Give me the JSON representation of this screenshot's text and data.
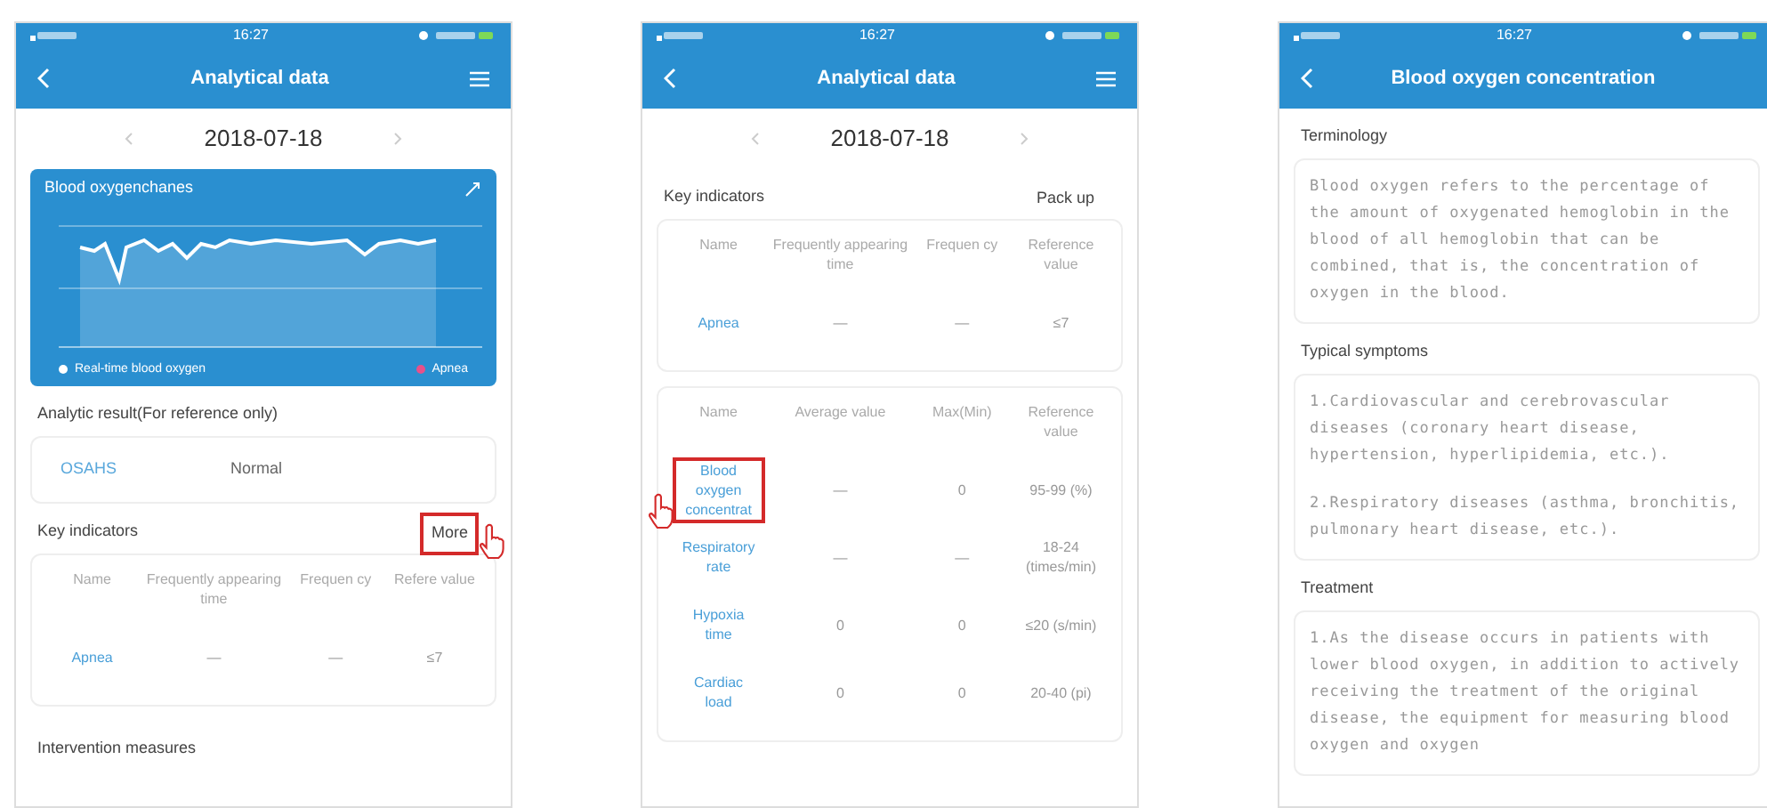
{
  "screens": [
    {
      "time": "16:27",
      "title": "Analytical data",
      "menu": true,
      "sections": [
        {
          "kind": "date",
          "label": "2018-07-18"
        },
        {
          "kind": "chart",
          "title": "Blood oxygenchanes",
          "legend": [
            {
              "label": "Real-time blood oxygen",
              "color": "#ffffff"
            },
            {
              "label": "Apnea",
              "color": "#e8508a"
            }
          ]
        },
        {
          "kind": "heading",
          "label": "Analytic result(For reference only)"
        },
        {
          "kind": "result",
          "name": "OSAHS",
          "value": "Normal"
        },
        {
          "kind": "heading",
          "label": "Key indicators",
          "action": {
            "label": "More",
            "highlighted": true
          }
        },
        {
          "kind": "table",
          "columns": [
            "Name",
            "Frequently appearing time",
            "Frequen cy",
            "Refere value"
          ],
          "rows": [
            {
              "cells": [
                "Apnea",
                "—",
                "—",
                "≤7"
              ],
              "highlighted": false
            }
          ]
        },
        {
          "kind": "heading",
          "label": "Intervention measures"
        }
      ]
    },
    {
      "time": "16:27",
      "title": "Analytical data",
      "menu": true,
      "sections": [
        {
          "kind": "date",
          "label": "2018-07-18"
        },
        {
          "kind": "heading",
          "label": "Key indicators",
          "action": {
            "label": "Pack up",
            "highlighted": false
          }
        },
        {
          "kind": "table",
          "columns": [
            "Name",
            "Frequently appearing time",
            "Frequen cy",
            "Reference value"
          ],
          "rows": [
            {
              "cells": [
                "Apnea",
                "—",
                "—",
                "≤7"
              ],
              "highlighted": false
            }
          ]
        },
        {
          "kind": "table",
          "columns": [
            "Name",
            "Average value",
            "Max(Min)",
            "Reference value"
          ],
          "rows": [
            {
              "cells": [
                "Blood oxygen concentrat",
                "—",
                "0",
                "95-99 (%)"
              ],
              "highlighted": true
            },
            {
              "cells": [
                "Respiratory rate",
                "—",
                "—",
                "18-24 (times/min)"
              ],
              "highlighted": false
            },
            {
              "cells": [
                "Hypoxia time",
                "0",
                "0",
                "≤20 (s/min)"
              ],
              "highlighted": false
            },
            {
              "cells": [
                "Cardiac load",
                "0",
                "0",
                "20-40 (pi)"
              ],
              "highlighted": false
            }
          ]
        }
      ]
    },
    {
      "time": "16:27",
      "title": "Blood oxygen concentration",
      "menu": false,
      "sections": [
        {
          "kind": "heading",
          "label": "Terminology"
        },
        {
          "kind": "text",
          "paragraphs": [
            "Blood oxygen refers to the percentage of the amount of oxygenated hemoglobin in the blood of all hemoglobin that can be combined, that is, the concentration of oxygen in the blood."
          ]
        },
        {
          "kind": "heading",
          "label": "Typical symptoms"
        },
        {
          "kind": "text",
          "paragraphs": [
            "1.Cardiovascular and cerebrovascular diseases (coronary heart disease, hypertension, hyperlipidemia, etc.).",
            "2.Respiratory diseases (asthma, bronchitis, pulmonary heart disease, etc.)."
          ]
        },
        {
          "kind": "heading",
          "label": "Treatment"
        },
        {
          "kind": "text",
          "paragraphs": [
            "1.As the disease occurs in patients with lower blood oxygen, in addition to actively receiving the treatment of the original disease, the equipment for measuring blood oxygen and oxygen"
          ]
        }
      ]
    }
  ]
}
